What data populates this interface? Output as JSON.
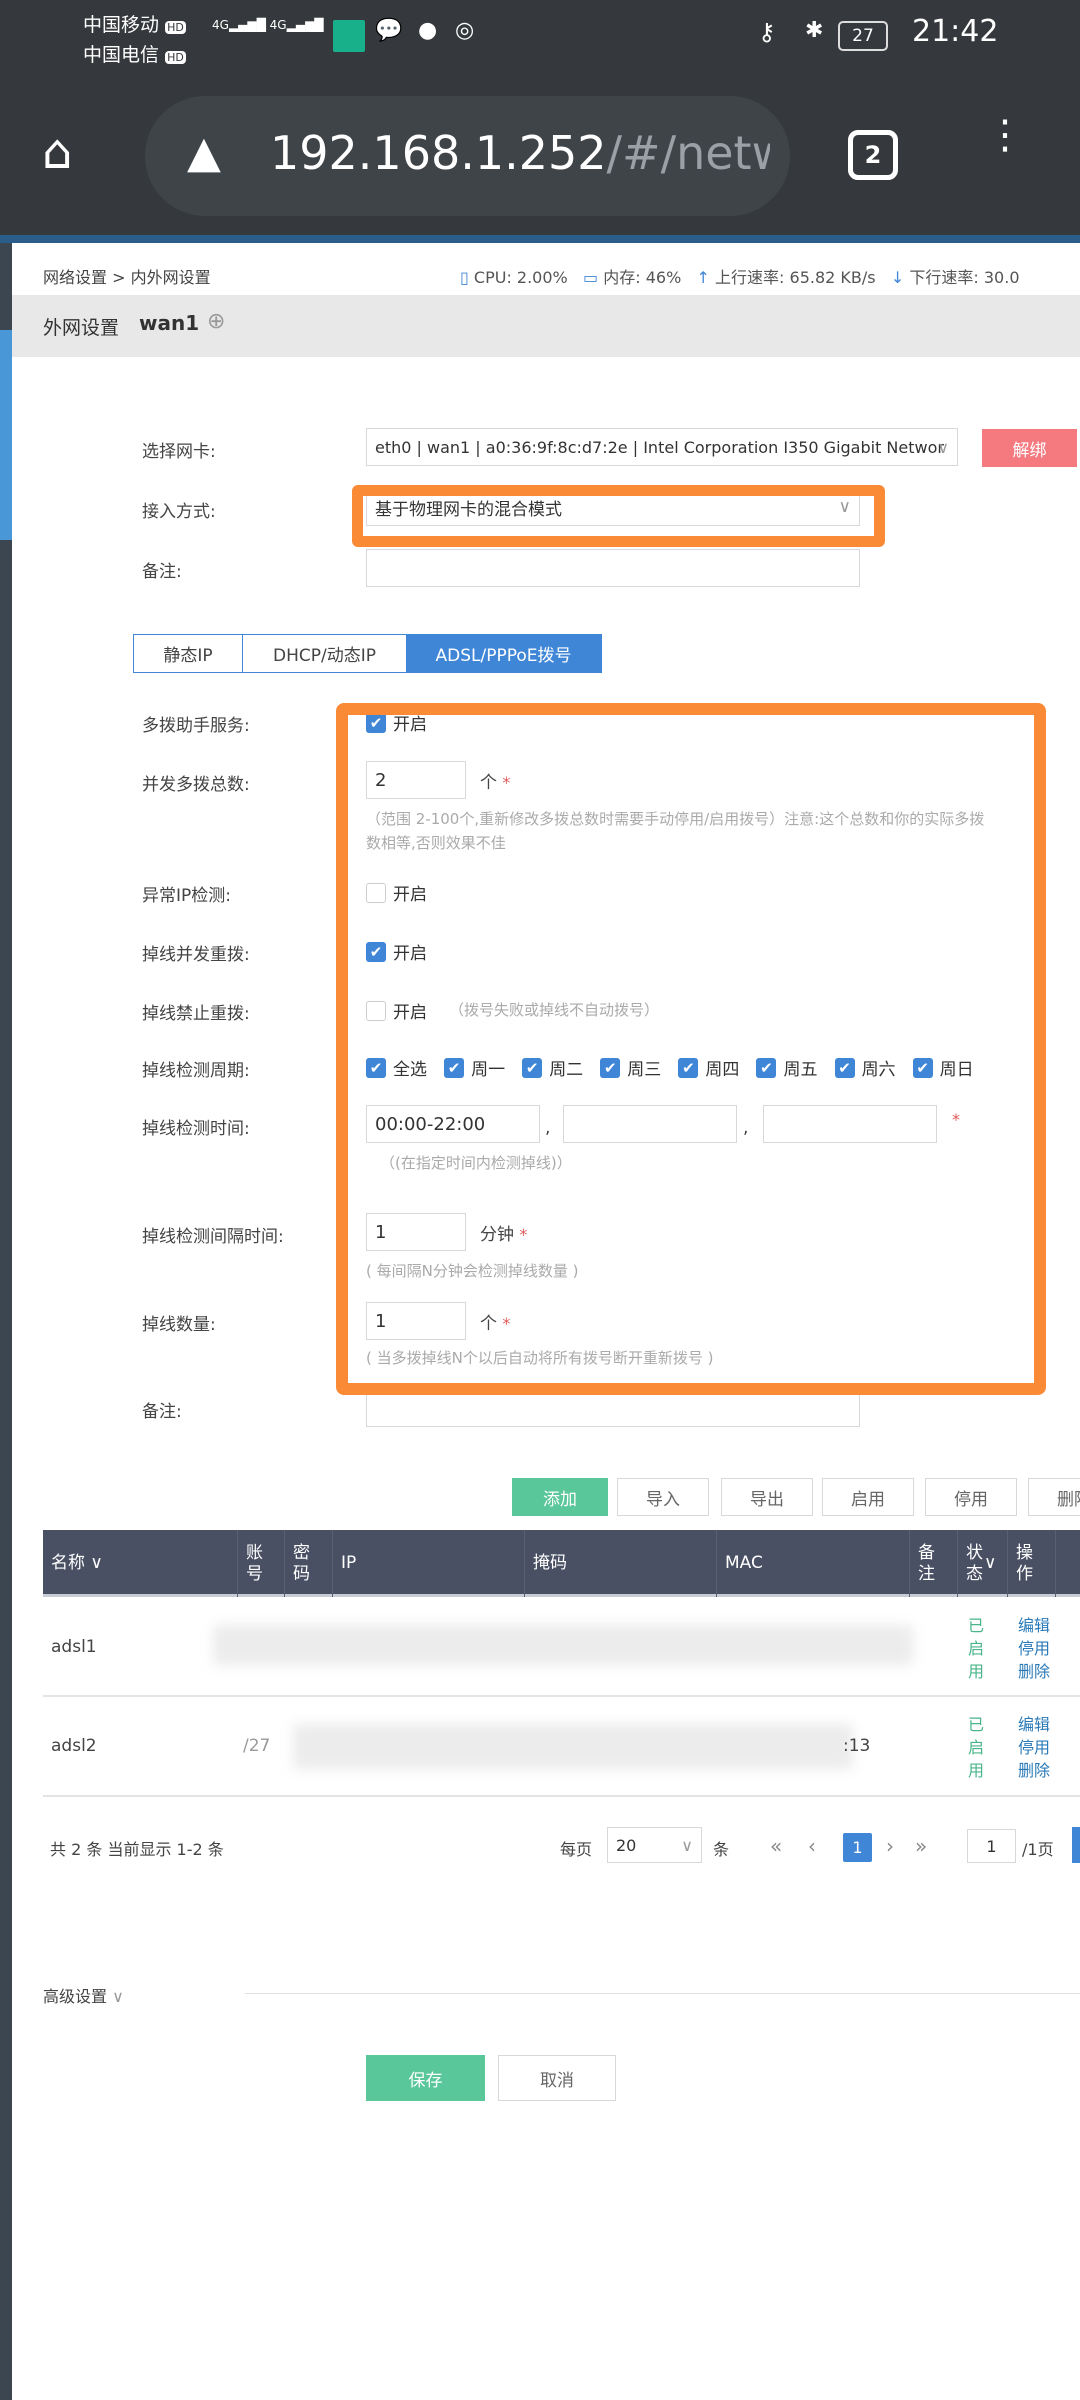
{
  "status_bar": {
    "carrier1": "中国移动",
    "carrier2": "中国电信",
    "hd": "HD",
    "net1": "4G",
    "net2": "4G",
    "battery": "27",
    "time": "21:42"
  },
  "browser": {
    "url_host": "192.168.1.252",
    "url_path": "/#/netwo",
    "tab_count": "2"
  },
  "top": {
    "breadcrumb": "网络设置 > 内外网设置",
    "cpu": "CPU: 2.00%",
    "mem": "内存: 46%",
    "up": "上行速率: 65.82 KB/s",
    "down": "下行速率: 30.0"
  },
  "header": {
    "title": "外网设置",
    "wan": "wan1"
  },
  "form": {
    "nic_label": "选择网卡:",
    "nic_value": "eth0 | wan1 | a0:36:9f:8c:d7:2e | Intel Corporation I350 Gigabit Networ",
    "unbind": "解绑",
    "access_label": "接入方式:",
    "access_value": "基于物理网卡的混合模式",
    "remark_label": "备注:",
    "tabs": [
      "静态IP",
      "DHCP/动态IP",
      "ADSL/PPPoE拨号"
    ],
    "enable": "开启",
    "helper_label": "多拨助手服务:",
    "total_label": "并发多拨总数:",
    "total_value": "2",
    "unit_ge": "个",
    "total_hint1": "（范围 2-100个,重新修改多拨总数时需要手动停用/启用拨号）注意:这个总数和你的实际多拨",
    "total_hint2": "数相等,否则效果不佳",
    "abnormal_label": "异常IP检测:",
    "redial_label": "掉线并发重拨:",
    "noredial_label": "掉线禁止重拨:",
    "noredial_hint": "（拨号失败或掉线不自动拨号）",
    "cycle_label": "掉线检测周期:",
    "days": [
      "全选",
      "周一",
      "周二",
      "周三",
      "周四",
      "周五",
      "周六",
      "周日"
    ],
    "time_label": "掉线检测时间:",
    "time_value": "00:00-22:00",
    "time_hint": "（(在指定时间内检测掉线)）",
    "interval_label": "掉线检测间隔时间:",
    "interval_value": "1",
    "unit_min": "分钟",
    "interval_hint": "( 每间隔N分钟会检测掉线数量 )",
    "count_label": "掉线数量:",
    "count_value": "1",
    "count_hint": "( 当多拨掉线N个以后自动将所有拨号断开重新拨号 )",
    "remark2_label": "备注:"
  },
  "toolbar": {
    "add": "添加",
    "import": "导入",
    "export": "导出",
    "enable": "启用",
    "disable": "停用",
    "delete": "删除"
  },
  "table": {
    "headers": [
      "名称",
      "账号",
      "密码",
      "IP",
      "掩码",
      "MAC",
      "备注",
      "状态",
      "操作"
    ],
    "rows": [
      {
        "name": "adsl1",
        "account": "",
        "mac": "",
        "status": "已启用"
      },
      {
        "name": "adsl2",
        "account": "/27",
        "mac": ":13",
        "status": "已启用"
      }
    ],
    "ops": [
      "编辑",
      "停用",
      "删除"
    ]
  },
  "pager": {
    "summary": "共 2 条 当前显示 1-2 条",
    "per_page": "每页",
    "size": "20",
    "unit": "条",
    "page": "1",
    "goto": "1",
    "total": "/1页"
  },
  "advanced": "高级设置",
  "save": "保存",
  "cancel": "取消"
}
